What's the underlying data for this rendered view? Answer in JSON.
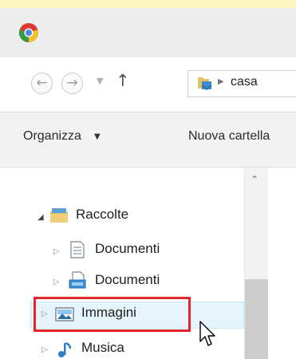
{
  "address_bar": {
    "crumb": "casa"
  },
  "toolbar": {
    "organize_label": "Organizza",
    "new_folder_label": "Nuova cartella"
  },
  "nav_tree": {
    "root": {
      "label": "Raccolte",
      "expanded": true
    },
    "items": [
      {
        "label": "Documenti",
        "icon": "document-icon"
      },
      {
        "label": "Documenti",
        "icon": "computer-document-icon"
      },
      {
        "label": "Immagini",
        "icon": "pictures-icon",
        "selected": true
      },
      {
        "label": "Musica",
        "icon": "music-icon"
      }
    ]
  },
  "colors": {
    "highlight_box": "#e0262a",
    "selection": "#e5f3fb",
    "top_strip": "#fdf5c2"
  }
}
